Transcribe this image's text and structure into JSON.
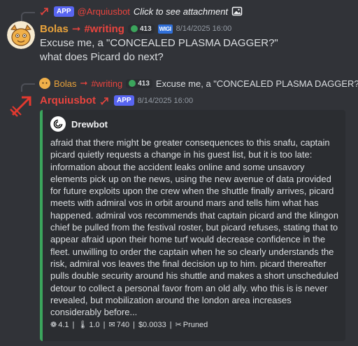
{
  "colors": {
    "background": "#313338",
    "embed_bg": "#2b2d31",
    "embed_accent": "#3ba55c",
    "app_badge": "#5865f2",
    "bolas_name": "#e8a23b",
    "arquiusbot_name": "#e8443e",
    "mention": "#c9cdfb"
  },
  "message1": {
    "reply": {
      "badge": "APP",
      "mention": "@Arquiusbot",
      "text": "Click to see attachment",
      "icon": "image-icon"
    },
    "author": "Bolas",
    "arrow": "➞",
    "channel": "#writing",
    "level": "413",
    "extra_badge": "WIGI",
    "timestamp": "8/14/2025 16:00",
    "lines": [
      "Excuse me, a \"CONCEALED PLASMA DAGGER?\"",
      "what does Picard do next?"
    ]
  },
  "message2": {
    "reply": {
      "author": "Bolas",
      "arrow": "➞",
      "channel": "#writing",
      "level": "413",
      "text": "Excuse me, a \"CONCEALED PLASMA DAGGER?..."
    },
    "author": "Arquiusbot",
    "badge": "APP",
    "timestamp": "8/14/2025 16:00",
    "embed": {
      "author": "Drewbot",
      "description": "afraid that there might be greater consequences to this snafu, captain picard quietly requests a change in his guest list, but it is too late: information about the accident leaks online and some unsavory elements pick up on the news, using the new avenue of data provided for future exploits upon the crew when the shuttle finally arrives, picard meets with admiral vos in orbit around mars and tells him what has happened. admiral vos recommends that captain picard and the klingon chief be pulled from the festival roster, but picard refuses, stating that to appear afraid upon their home turf would decrease confidence in the fleet. unwilling to order the captain when he so clearly understands the risk, admiral vos leaves the final decision up to him. picard thereafter pulls double security around his shuttle and makes a short unscheduled detour to collect a personal favor from an old ally. who this is is never revealed, but mobilization around the london area increases considerably before...",
      "footer": {
        "temp_model": "4.1",
        "temperature": "1.0",
        "tokens": "740",
        "cost": "$0.0033",
        "status": "Pruned",
        "sep": "|"
      }
    }
  }
}
